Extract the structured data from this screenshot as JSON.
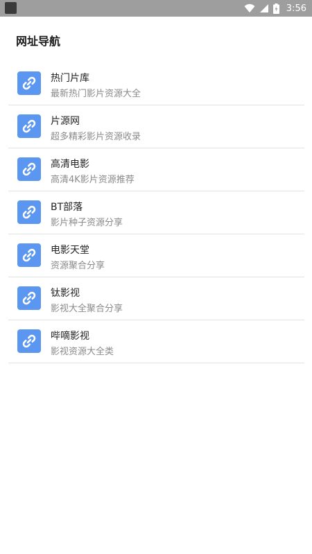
{
  "status_bar": {
    "time": "3:56",
    "icons": [
      "app-icon",
      "wifi-icon",
      "signal-icon",
      "battery-icon"
    ]
  },
  "page": {
    "title": "网址导航"
  },
  "list": {
    "icon": "link-icon",
    "accent_color": "#5b97f0",
    "items": [
      {
        "title": "热门片库",
        "subtitle": "最新热门影片资源大全"
      },
      {
        "title": "片源网",
        "subtitle": "超多精彩影片资源收录"
      },
      {
        "title": "高清电影",
        "subtitle": "高清4K影片资源推荐"
      },
      {
        "title": "BT部落",
        "subtitle": "影片种子资源分享"
      },
      {
        "title": "电影天堂",
        "subtitle": "资源聚合分享"
      },
      {
        "title": "钛影视",
        "subtitle": "影视大全聚合分享"
      },
      {
        "title": "哔嘀影视",
        "subtitle": "影视资源大全类"
      }
    ]
  }
}
